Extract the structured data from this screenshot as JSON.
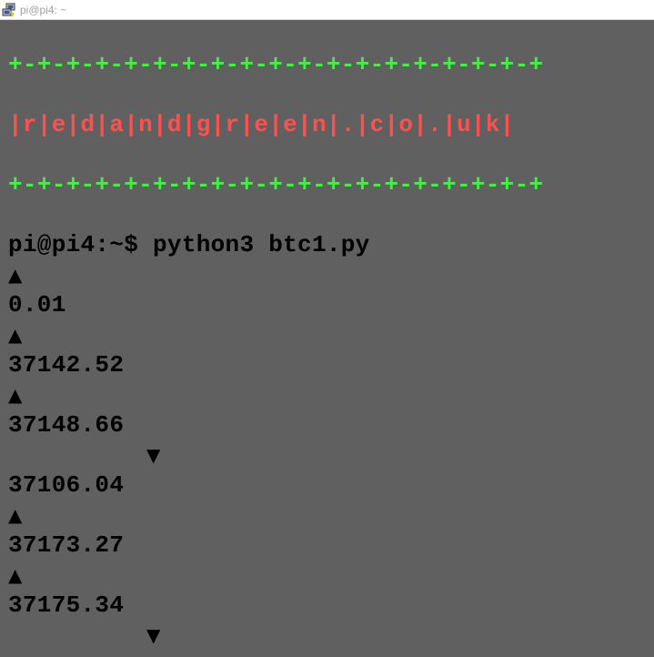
{
  "window": {
    "title": "pi@pi4: ~",
    "icon": "putty-icon"
  },
  "terminal": {
    "banner_top": "+-+-+-+-+-+-+-+-+-+-+-+-+-+-+-+-+-+-+",
    "banner_middle": "|r|e|d|a|n|d|g|r|e|e|n|.|c|o|.|u|k|",
    "banner_bottom": "+-+-+-+-+-+-+-+-+-+-+-+-+-+-+-+-+-+-+",
    "prompt": "pi@pi4:~$ python3 btc1.py",
    "entries": [
      {
        "arrow": "▲",
        "direction": "up",
        "value": "0.01"
      },
      {
        "arrow": "▲",
        "direction": "up",
        "value": "37142.52"
      },
      {
        "arrow": "▲",
        "direction": "up",
        "value": "37148.66"
      },
      {
        "arrow": "▼",
        "direction": "down",
        "value": "37106.04"
      },
      {
        "arrow": "▲",
        "direction": "up",
        "value": "37173.27"
      },
      {
        "arrow": "▲",
        "direction": "up",
        "value": "37175.34"
      }
    ],
    "trailing_arrow": "▼",
    "colors": {
      "background": "#606060",
      "banner_border": "#44ee44",
      "banner_text": "#ff5050",
      "text": "#000000"
    }
  }
}
